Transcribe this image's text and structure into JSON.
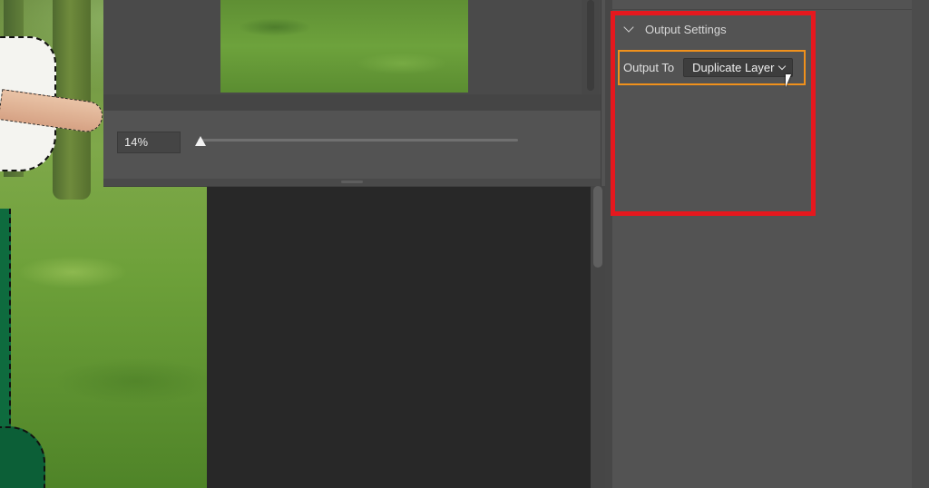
{
  "dialog": {
    "zoom_value": "14%",
    "zoom_fraction": 0.14
  },
  "panel": {
    "section_title": "Output Settings",
    "output_label": "Output To",
    "output_value": "Duplicate Layer"
  },
  "annotations": {
    "section_highlight_color": "#e5181e",
    "control_highlight_color": "#f0911c"
  },
  "icons": {
    "section_toggle": "chevron-down-icon",
    "dropdown_toggle": "chevron-down-icon",
    "pointer": "mouse-cursor-icon"
  }
}
